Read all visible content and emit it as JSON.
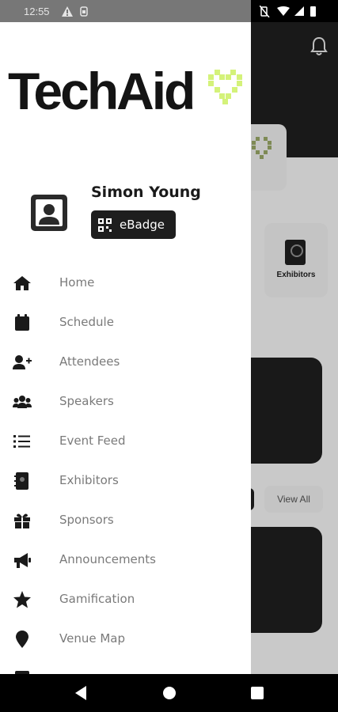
{
  "status_bar": {
    "time": "12:55"
  },
  "drawer": {
    "logo_text": "TechAid",
    "profile": {
      "name": "Simon Young",
      "badge_label": "eBadge"
    },
    "menu": [
      {
        "label": "Home",
        "icon": "home-icon"
      },
      {
        "label": "Schedule",
        "icon": "calendar-icon"
      },
      {
        "label": "Attendees",
        "icon": "add-user-icon"
      },
      {
        "label": "Speakers",
        "icon": "users-icon"
      },
      {
        "label": "Event Feed",
        "icon": "list-icon"
      },
      {
        "label": "Exhibitors",
        "icon": "contact-book-icon"
      },
      {
        "label": "Sponsors",
        "icon": "gift-icon"
      },
      {
        "label": "Announcements",
        "icon": "megaphone-icon"
      },
      {
        "label": "Gamification",
        "icon": "star-icon"
      },
      {
        "label": "Venue Map",
        "icon": "map-pin-icon"
      },
      {
        "label": "",
        "icon": "document-icon"
      }
    ]
  },
  "background_app": {
    "exhibitors_label": "Exhibitors",
    "view_all_label": "View All"
  },
  "colors": {
    "accent": "#d4f27a",
    "dark": "#191919",
    "scrim": "#c9c9c9",
    "menu_text": "#7a7a7a"
  }
}
